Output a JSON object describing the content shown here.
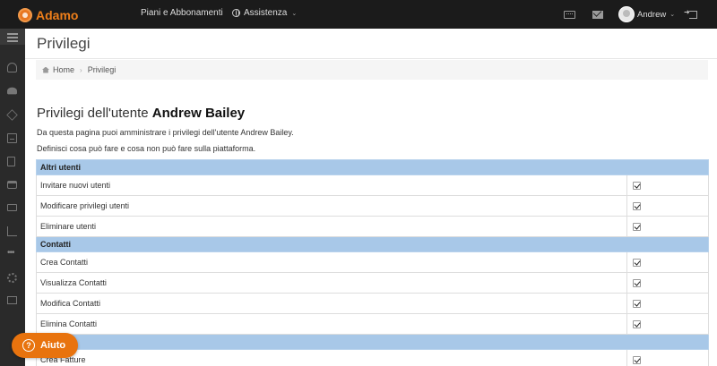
{
  "navbar": {
    "brand": "Adamo",
    "plans_label": "Piani e Abbonamenti",
    "help_label": "Assistenza",
    "user_name": "Andrew",
    "icons": [
      "keyboard-icon",
      "mail-icon",
      "logout-icon"
    ]
  },
  "sidebar": {
    "icons": [
      "menu-toggle-icon",
      "dashboard-icon",
      "users-icon",
      "products-icon",
      "calculator-icon",
      "document-icon",
      "inbox-icon",
      "money-icon",
      "chart-icon",
      "more-icon",
      "settings-icon",
      "gift-icon"
    ]
  },
  "page": {
    "title": "Privilegi",
    "breadcrumb": {
      "home": "Home",
      "current": "Privilegi"
    },
    "heading_prefix": "Privilegi dell'utente",
    "heading_user": "Andrew Bailey",
    "description1": "Da questa pagina puoi amministrare i privilegi dell'utente Andrew Bailey.",
    "description2": "Definisci cosa può fare e cosa non può fare sulla piattaforma."
  },
  "permissions": {
    "group_other_users": "Altri utenti",
    "invite_users": "Invitare nuovi utenti",
    "edit_privileges": "Modificare privilegi utenti",
    "delete_users": "Eliminare utenti",
    "group_contacts": "Contatti",
    "create_contacts": "Crea Contatti",
    "view_contacts": "Visualizza Contatti",
    "edit_contacts": "Modifica Contatti",
    "delete_contacts": "Elimina Contatti",
    "create_invoices": "Crea Fatture"
  },
  "help_button": {
    "label": "Aiuto"
  }
}
